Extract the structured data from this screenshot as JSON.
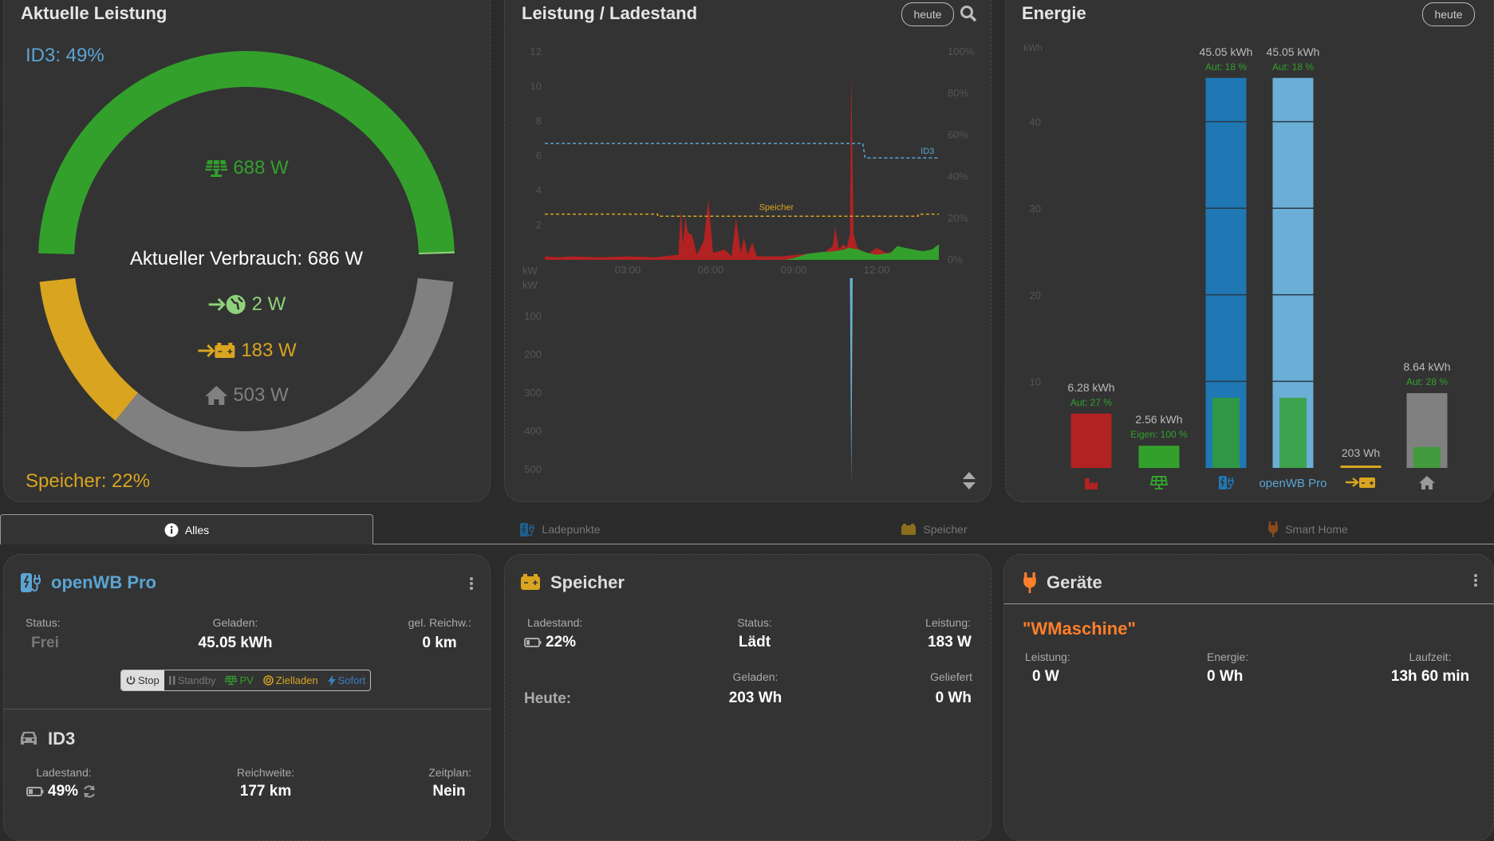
{
  "colors": {
    "pv": "#33a02c",
    "grid_import": "#b22222",
    "grid": "#8fd17a",
    "battery": "#d9a520",
    "house": "#808080",
    "vehicle": "#5ba4d4",
    "chargepoint": "#1f77b4",
    "chargepoint_light": "#6baed6",
    "smarthome": "#ff7f2a",
    "card_bg": "#333333",
    "page_bg": "#2b2b2b"
  },
  "power_card": {
    "title": "Aktuelle Leistung",
    "vehicle_soc": "ID3: 49%",
    "battery_soc": "Speicher: 22%",
    "pv": "688 W",
    "consumption": "Aktueller Verbrauch: 686 W",
    "grid": "2 W",
    "battery": "183 W",
    "house": "503 W",
    "sources": [
      {
        "id": "pv",
        "value": 688
      },
      {
        "id": "grid",
        "value": 2
      }
    ],
    "consumers": [
      {
        "id": "battery",
        "value": 183
      },
      {
        "id": "house",
        "value": 503
      }
    ]
  },
  "chart_card": {
    "title": "Leistung / Ladestand",
    "range_button": "heute",
    "search_icon": "search-icon",
    "scroll_icon": "sort-icon"
  },
  "energy_card": {
    "title": "Energie",
    "range_button": "heute"
  },
  "tabs": [
    {
      "label": "Alles",
      "icon": "info-icon",
      "active": true
    },
    {
      "label": "Ladepunkte",
      "icon": "charging-station-icon",
      "active": false
    },
    {
      "label": "Speicher",
      "icon": "battery-icon",
      "active": false
    },
    {
      "label": "Smart Home",
      "icon": "plug-icon",
      "active": false
    }
  ],
  "chargepoint": {
    "name": "openWB Pro",
    "status_label": "Status:",
    "status": "Frei",
    "charged_label": "Geladen:",
    "charged": "45.05 kWh",
    "range_label": "gel. Reichw.:",
    "range": "0 km",
    "modes": [
      {
        "label": "Stop",
        "icon": "power-icon",
        "active": true
      },
      {
        "label": "Standby",
        "icon": "pause-icon"
      },
      {
        "label": "PV",
        "icon": "solar-panel-icon"
      },
      {
        "label": "Zielladen",
        "icon": "target-icon"
      },
      {
        "label": "Sofort",
        "icon": "bolt-icon"
      }
    ]
  },
  "vehicle": {
    "name": "ID3",
    "soc_label": "Ladestand:",
    "soc": "49%",
    "range_label": "Reichweite:",
    "range": "177 km",
    "plan_label": "Zeitplan:",
    "plan": "Nein"
  },
  "battery": {
    "title": "Speicher",
    "soc_label": "Ladestand:",
    "soc": "22%",
    "status_label": "Status:",
    "status": "Lädt",
    "power_label": "Leistung:",
    "power": "183 W",
    "today_label": "Heute:",
    "charged_label": "Geladen:",
    "charged": "203 Wh",
    "delivered_label": "Geliefert",
    "delivered": "0 Wh"
  },
  "devices": {
    "title": "Geräte",
    "device_name": "\"WMaschine\"",
    "power_label": "Leistung:",
    "power": "0 W",
    "energy_label": "Energie:",
    "energy": "0 Wh",
    "runtime_label": "Laufzeit:",
    "runtime": "13h 60 min"
  },
  "chart_data": [
    {
      "type": "area",
      "title": "Leistung / Ladestand",
      "ylabel": "kW",
      "ylim": [
        0,
        12
      ],
      "yticks": [
        2,
        4,
        6,
        8,
        10,
        12
      ],
      "y2ticks": [
        "0%",
        "20%",
        "40%",
        "60%",
        "80%",
        "100%"
      ],
      "y2lim": [
        0,
        100
      ],
      "xticks": [
        "03:00",
        "06:00",
        "09:00",
        "12:00"
      ],
      "series": [
        {
          "id": "grid",
          "color": "#b22222",
          "points": [
            [
              "00:00",
              0.2
            ],
            [
              "00:30",
              0.15
            ],
            [
              "01:00",
              0.2
            ],
            [
              "02:00",
              0.15
            ],
            [
              "03:00",
              0.2
            ],
            [
              "04:00",
              0.15
            ],
            [
              "04:50",
              0.3
            ],
            [
              "04:55",
              2.9
            ],
            [
              "05:00",
              0.9
            ],
            [
              "05:05",
              2.5
            ],
            [
              "05:10",
              1.6
            ],
            [
              "05:20",
              1.4
            ],
            [
              "05:30",
              0.3
            ],
            [
              "05:45",
              1.1
            ],
            [
              "05:55",
              3.5
            ],
            [
              "06:05",
              0.4
            ],
            [
              "06:30",
              0.6
            ],
            [
              "06:45",
              0.2
            ],
            [
              "06:55",
              2.4
            ],
            [
              "07:05",
              0.4
            ],
            [
              "07:12",
              1.3
            ],
            [
              "07:20",
              0.3
            ],
            [
              "07:30",
              1.0
            ],
            [
              "07:40",
              0.2
            ],
            [
              "08:30",
              0.2
            ],
            [
              "09:30",
              0.35
            ],
            [
              "10:00",
              0.3
            ],
            [
              "10:25",
              0.8
            ],
            [
              "10:30",
              1.9
            ],
            [
              "10:38",
              0.6
            ],
            [
              "10:48",
              0.9
            ],
            [
              "10:55",
              0.7
            ],
            [
              "11:02",
              1.5
            ],
            [
              "11:05",
              10.8
            ],
            [
              "11:10",
              1.5
            ],
            [
              "11:18",
              0.7
            ],
            [
              "11:40",
              0.3
            ],
            [
              "12:00",
              0.7
            ],
            [
              "12:20",
              0.4
            ],
            [
              "12:40",
              0.5
            ],
            [
              "13:00",
              0.4
            ],
            [
              "13:30",
              0.5
            ],
            [
              "14:00",
              0.4
            ],
            [
              "14:15",
              0.8
            ]
          ]
        },
        {
          "id": "pv",
          "color": "#33a02c",
          "points": [
            [
              "08:40",
              0
            ],
            [
              "09:00",
              0.1
            ],
            [
              "09:30",
              0.35
            ],
            [
              "10:00",
              0.45
            ],
            [
              "10:30",
              0.5
            ],
            [
              "10:50",
              0.6
            ],
            [
              "11:00",
              0.7
            ],
            [
              "11:20",
              0.6
            ],
            [
              "11:40",
              0.4
            ],
            [
              "12:00",
              0.3
            ],
            [
              "12:30",
              0.4
            ],
            [
              "12:45",
              0.8
            ],
            [
              "13:00",
              0.7
            ],
            [
              "13:20",
              0.6
            ],
            [
              "13:40",
              0.5
            ],
            [
              "14:00",
              0.6
            ],
            [
              "14:15",
              0.9
            ]
          ]
        }
      ],
      "soc_series": [
        {
          "name": "Speicher",
          "color": "#d9a520",
          "points": [
            [
              "00:00",
              22
            ],
            [
              "04:05",
              22
            ],
            [
              "04:05",
              21
            ],
            [
              "13:30",
              21
            ],
            [
              "13:30",
              22
            ],
            [
              "14:15",
              22
            ]
          ]
        },
        {
          "name": "ID3",
          "color": "#5ba4d4",
          "points": [
            [
              "00:00",
              56
            ],
            [
              "11:30",
              56
            ],
            [
              "11:35",
              49
            ],
            [
              "14:15",
              49
            ]
          ]
        }
      ]
    },
    {
      "type": "area",
      "ylabel": "kW",
      "ylim": [
        0,
        500
      ],
      "yticks": [
        100,
        200,
        300,
        400,
        500
      ],
      "inverted": true,
      "series": [
        {
          "id": "chargepoint",
          "color": "#6baed6",
          "points": [
            [
              "11:02",
              0
            ],
            [
              "11:05",
              540
            ],
            [
              "11:08",
              0
            ]
          ]
        }
      ]
    },
    {
      "type": "bar",
      "title": "Energie",
      "ylabel": "kWh",
      "yticks": [
        10,
        20,
        30,
        40
      ],
      "ylim": [
        0,
        47
      ],
      "bars": [
        {
          "id": "grid",
          "icon": "factory-icon",
          "value": 6.28,
          "label": "6.28 kWh",
          "sub": "Aut: 27 %",
          "color": "#b22222"
        },
        {
          "id": "pv",
          "icon": "solar-panel-icon",
          "value": 2.56,
          "label": "2.56 kWh",
          "sub": "Eigen: 100 %",
          "color": "#33a02c"
        },
        {
          "id": "chargepoints",
          "icon": "charging-station-icon",
          "value": 45.05,
          "label": "45.05 kWh",
          "sub": "Aut: 18 %",
          "autarky": 18,
          "color": "#1f77b4"
        },
        {
          "id": "openwb-pro",
          "name": "openWB Pro",
          "value": 45.05,
          "label": "45.05 kWh",
          "sub": "Aut: 18 %",
          "autarky": 18,
          "color": "#6baed6"
        },
        {
          "id": "battery",
          "icon": "battery-charge-icon",
          "value": 0.203,
          "label": "203 Wh",
          "color": "#d9a520"
        },
        {
          "id": "house",
          "icon": "house-icon",
          "value": 8.64,
          "label": "8.64 kWh",
          "sub": "Aut: 28 %",
          "autarky": 28,
          "color": "#808080"
        }
      ]
    }
  ]
}
